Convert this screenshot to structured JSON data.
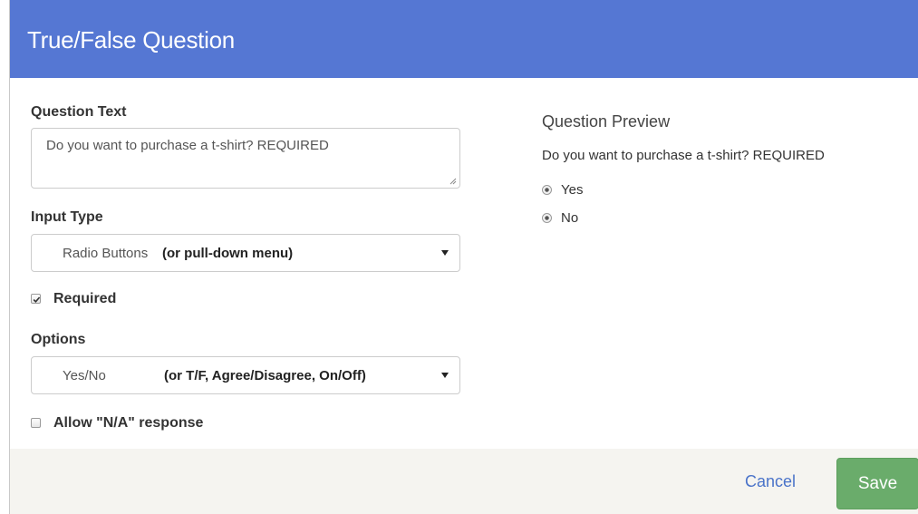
{
  "dialog": {
    "title": "True/False Question"
  },
  "form": {
    "question_text_label": "Question Text",
    "question_text_value": "Do you want to purchase a t-shirt? REQUIRED",
    "input_type_label": "Input Type",
    "input_type_value": "Radio Buttons",
    "input_type_hint": "(or pull-down menu)",
    "required_label": "Required",
    "required_checked": true,
    "options_label": "Options",
    "options_value": "Yes/No",
    "options_hint": "(or T/F, Agree/Disagree, On/Off)",
    "allow_na_label": "Allow \"N/A\" response",
    "allow_na_checked": false
  },
  "preview": {
    "title": "Question Preview",
    "question": "Do you want to purchase a t-shirt? REQUIRED",
    "options": [
      "Yes",
      "No"
    ]
  },
  "footer": {
    "cancel_label": "Cancel",
    "save_label": "Save"
  },
  "colors": {
    "header": "#5577d3",
    "save": "#6aac6b",
    "link": "#4a73c9",
    "footer": "#f5f4f0"
  },
  "icons": [
    "resize-grip-icon",
    "caret-down-icon",
    "check-icon"
  ]
}
